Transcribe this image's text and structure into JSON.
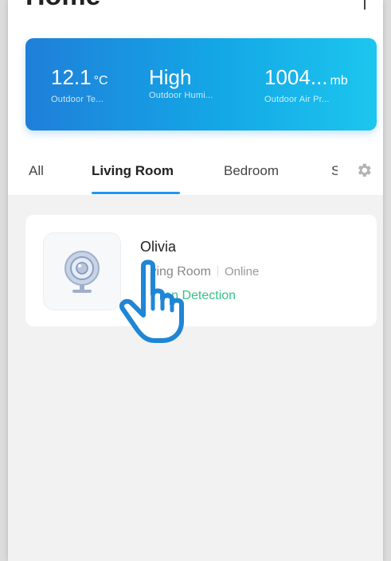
{
  "header": {
    "title": "Home"
  },
  "weather": [
    {
      "value": "12.1",
      "unit": "°C",
      "label": "Outdoor Te..."
    },
    {
      "value": "High",
      "unit": "",
      "label": "Outdoor Humi..."
    },
    {
      "value": "1004...",
      "unit": "mb",
      "label": "Outdoor Air Pr..."
    }
  ],
  "tabs": [
    {
      "label": "All"
    },
    {
      "label": "Living Room",
      "active": true
    },
    {
      "label": "Bedroom"
    },
    {
      "label": "S"
    }
  ],
  "device": {
    "name": "Olivia",
    "room": "Living Room",
    "status": "Online",
    "feature": "Motion Detection"
  },
  "colors": {
    "accent": "#2196f3",
    "feature_green": "#35c28b",
    "weather_start": "#1f7fd9",
    "weather_end": "#1cc6ee"
  },
  "icons": [
    "gear-icon",
    "camera-icon",
    "hand-pointer-icon"
  ]
}
